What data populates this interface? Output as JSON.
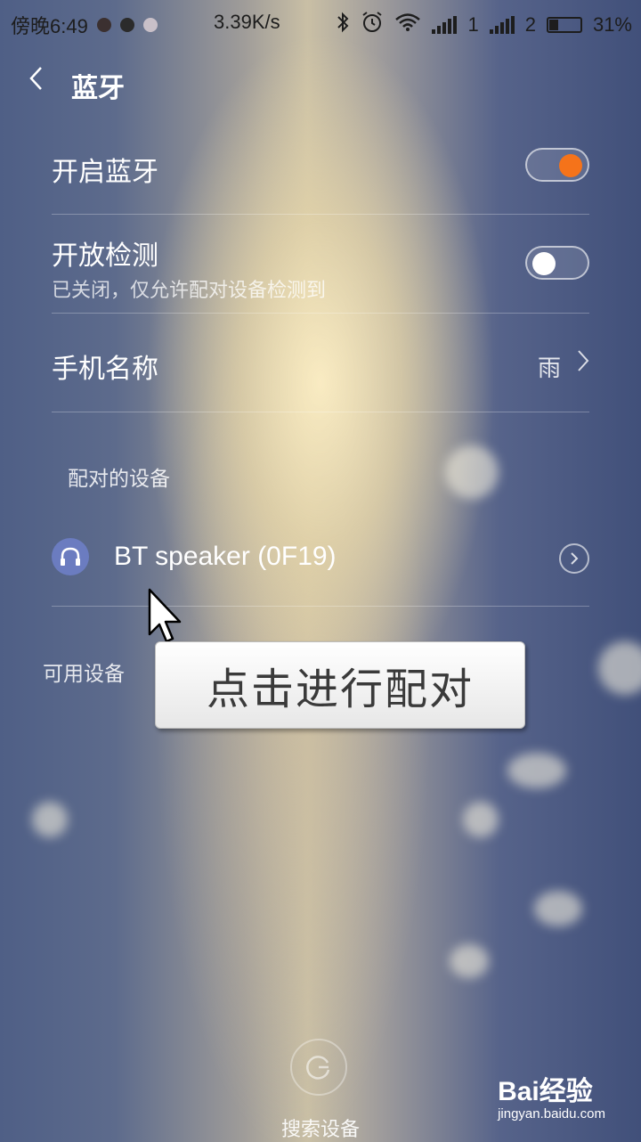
{
  "status_bar": {
    "time": "傍晚6:49",
    "net_speed": "3.39K/s",
    "sim1": "1",
    "sim2": "2",
    "battery": "31%"
  },
  "header": {
    "title": "蓝牙"
  },
  "settings": {
    "bluetooth": {
      "label": "开启蓝牙",
      "on": true
    },
    "discoverable": {
      "label": "开放检测",
      "subtitle": "已关闭，仅允许配对设备检测到",
      "on": false
    },
    "phone_name": {
      "label": "手机名称",
      "value": "雨"
    }
  },
  "paired_section": {
    "title": "配对的设备",
    "devices": [
      {
        "name": "BT speaker (0F19)",
        "icon": "headphones-icon"
      }
    ]
  },
  "available_section": {
    "title": "可用设备"
  },
  "tooltip": {
    "text": "点击进行配对"
  },
  "search": {
    "label": "搜索设备"
  },
  "watermark": {
    "logo": "Bai经验",
    "url": "jingyan.baidu.com"
  },
  "colors": {
    "accent": "#f5731a",
    "device_icon": "#6b7cc0"
  }
}
